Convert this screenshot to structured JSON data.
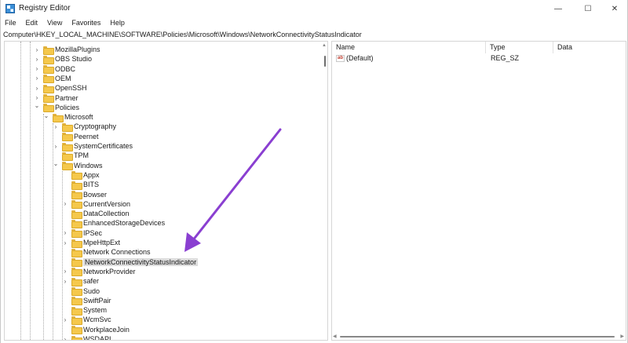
{
  "window": {
    "title": "Registry Editor",
    "minimize_glyph": "—",
    "maximize_glyph": "☐",
    "close_glyph": "✕"
  },
  "menu": [
    "File",
    "Edit",
    "View",
    "Favorites",
    "Help"
  ],
  "address": "Computer\\HKEY_LOCAL_MACHINE\\SOFTWARE\\Policies\\Microsoft\\Windows\\NetworkConnectivityStatusIndicator",
  "tree": {
    "items": [
      {
        "label": "MozillaPlugins",
        "expander": "collapsed"
      },
      {
        "label": "OBS Studio",
        "expander": "collapsed"
      },
      {
        "label": "ODBC",
        "expander": "collapsed"
      },
      {
        "label": "OEM",
        "expander": "collapsed"
      },
      {
        "label": "OpenSSH",
        "expander": "collapsed"
      },
      {
        "label": "Partner",
        "expander": "collapsed"
      },
      {
        "label": "Policies",
        "expander": "expanded"
      },
      {
        "label": "Microsoft",
        "expander": "expanded"
      },
      {
        "label": "Cryptography",
        "expander": "collapsed"
      },
      {
        "label": "Peernet",
        "expander": "none"
      },
      {
        "label": "SystemCertificates",
        "expander": "collapsed"
      },
      {
        "label": "TPM",
        "expander": "none"
      },
      {
        "label": "Windows",
        "expander": "expanded"
      },
      {
        "label": "Appx",
        "expander": "none"
      },
      {
        "label": "BITS",
        "expander": "none"
      },
      {
        "label": "Bowser",
        "expander": "none"
      },
      {
        "label": "CurrentVersion",
        "expander": "collapsed"
      },
      {
        "label": "DataCollection",
        "expander": "none"
      },
      {
        "label": "EnhancedStorageDevices",
        "expander": "none"
      },
      {
        "label": "IPSec",
        "expander": "collapsed"
      },
      {
        "label": "MpeHttpExt",
        "expander": "collapsed"
      },
      {
        "label": "Network Connections",
        "expander": "none"
      },
      {
        "label": "NetworkConnectivityStatusIndicator",
        "expander": "none",
        "selected": true
      },
      {
        "label": "NetworkProvider",
        "expander": "collapsed"
      },
      {
        "label": "safer",
        "expander": "collapsed"
      },
      {
        "label": "Sudo",
        "expander": "none"
      },
      {
        "label": "SwiftPair",
        "expander": "none"
      },
      {
        "label": "System",
        "expander": "none"
      },
      {
        "label": "WcmSvc",
        "expander": "collapsed"
      },
      {
        "label": "WorkplaceJoin",
        "expander": "none"
      },
      {
        "label": "WSDAPI",
        "expander": "collapsed"
      }
    ]
  },
  "list": {
    "columns": [
      "Name",
      "Type",
      "Data"
    ],
    "rows": [
      {
        "icon": "string-value-icon",
        "icon_text": "ab",
        "name": "(Default)",
        "type": "REG_SZ",
        "data": ""
      }
    ]
  },
  "colors": {
    "annotation_arrow": "#8a3fd1",
    "folder": "#f5c84c",
    "selection": "#dcdcdc"
  }
}
